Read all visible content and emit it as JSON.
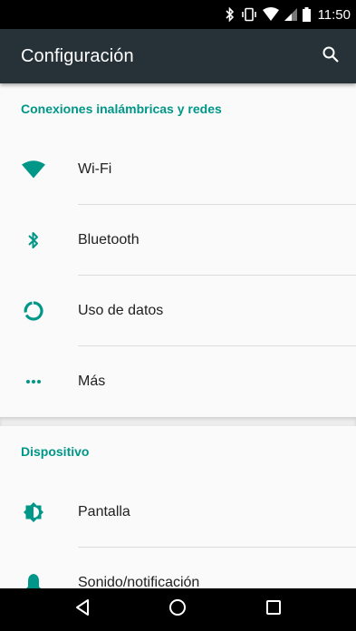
{
  "status_bar": {
    "time": "11:50",
    "icons": [
      "bluetooth-icon",
      "vibrate-icon",
      "wifi-icon",
      "signal-icon",
      "battery-icon"
    ]
  },
  "app_bar": {
    "title": "Configuración",
    "background": "#263238",
    "search_icon": "search-icon"
  },
  "sections": [
    {
      "header": "Conexiones inalámbricas y redes",
      "items": [
        {
          "label": "Wi-Fi",
          "icon": "wifi-icon"
        },
        {
          "label": "Bluetooth",
          "icon": "bluetooth-icon"
        },
        {
          "label": "Uso de datos",
          "icon": "data-usage-icon"
        },
        {
          "label": "Más",
          "icon": "more-icon"
        }
      ]
    },
    {
      "header": "Dispositivo",
      "items": [
        {
          "label": "Pantalla",
          "icon": "brightness-icon"
        },
        {
          "label": "Sonido/notificación",
          "icon": "bell-icon"
        }
      ]
    }
  ],
  "accent_color": "#009688",
  "nav_bar": {
    "buttons": [
      "back-icon",
      "home-icon",
      "recents-icon"
    ]
  }
}
